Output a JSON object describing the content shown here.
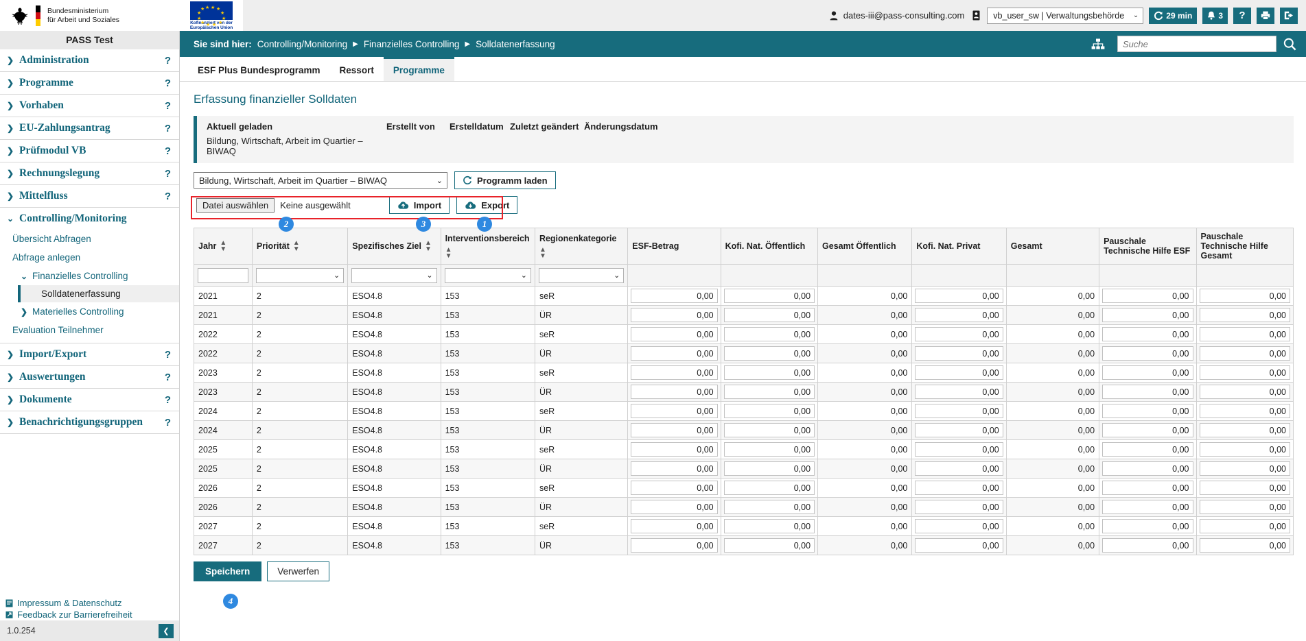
{
  "header": {
    "ministry_line1": "Bundesministerium",
    "ministry_line2": "für Arbeit und Soziales",
    "eu_caption_line1": "Kofinanziert von der",
    "eu_caption_line2": "Europäischen Union",
    "user_email": "dates-iii@pass-consulting.com",
    "user_icon": "user-icon",
    "id_card_icon": "id-card-icon",
    "role_value": "vb_user_sw | Verwaltungsbehörde",
    "session_timer": "29 min",
    "session_icon": "refresh-icon",
    "notifications_count": "3",
    "notifications_icon": "bell-icon",
    "help_label": "?",
    "help_icon": "question-mark-icon",
    "print_icon": "printer-icon",
    "logout_icon": "logout-icon"
  },
  "breadcrumb": {
    "prefix": "Sie sind hier:",
    "items": [
      "Controlling/Monitoring",
      "Finanzielles Controlling",
      "Solldatenerfassung"
    ],
    "separator": "▶",
    "sitemap_icon": "sitemap-icon",
    "search_placeholder": "Suche",
    "search_value": "",
    "search_icon": "search-icon"
  },
  "tabs": [
    {
      "label": "ESF Plus Bundesprogramm",
      "active": false
    },
    {
      "label": "Ressort",
      "active": false
    },
    {
      "label": "Programme",
      "active": true
    }
  ],
  "sidebar": {
    "app_title": "PASS Test",
    "items": [
      {
        "label": "Administration",
        "expanded": false,
        "help": "?"
      },
      {
        "label": "Programme",
        "expanded": false,
        "help": "?"
      },
      {
        "label": "Vorhaben",
        "expanded": false,
        "help": "?"
      },
      {
        "label": "EU-Zahlungsantrag",
        "expanded": false,
        "help": "?"
      },
      {
        "label": "Prüfmodul VB",
        "expanded": false,
        "help": "?"
      },
      {
        "label": "Rechnungslegung",
        "expanded": false,
        "help": "?"
      },
      {
        "label": "Mittelfluss",
        "expanded": false,
        "help": "?"
      },
      {
        "label": "Controlling/Monitoring",
        "expanded": true,
        "help": ""
      }
    ],
    "sub_items": [
      {
        "label": "Übersicht Abfragen",
        "level": 1
      },
      {
        "label": "Abfrage anlegen",
        "level": 1
      },
      {
        "label": "Finanzielles Controlling",
        "level": 2,
        "expanded": true
      },
      {
        "label": "Solldatenerfassung",
        "level": 3,
        "active": true
      },
      {
        "label": "Materielles Controlling",
        "level": 2,
        "expanded": false
      },
      {
        "label": "Evaluation Teilnehmer",
        "level": 1
      }
    ],
    "items_bottom": [
      {
        "label": "Import/Export",
        "expanded": false,
        "help": "?"
      },
      {
        "label": "Auswertungen",
        "expanded": false,
        "help": "?"
      },
      {
        "label": "Dokumente",
        "expanded": false,
        "help": "?"
      },
      {
        "label": "Benachrichtigungsgruppen",
        "expanded": false,
        "help": "?"
      }
    ],
    "footer_links": [
      {
        "label": "Impressum & Datenschutz",
        "icon": "document-icon"
      },
      {
        "label": "Feedback zur Barrierefreiheit",
        "icon": "external-link-icon"
      }
    ],
    "version": "1.0.254",
    "collapse_icon": "chevron-left-icon"
  },
  "main": {
    "page_title": "Erfassung finanzieller Solldaten",
    "loaded_panel": {
      "headers": [
        "Aktuell geladen",
        "Erstellt von",
        "Erstelldatum",
        "Zuletzt geändert",
        "Änderungsdatum"
      ],
      "values": [
        "Bildung, Wirtschaft, Arbeit im Quartier – BIWAQ",
        "",
        "",
        "",
        ""
      ]
    },
    "toolbar": {
      "program_select_value": "Bildung, Wirtschaft, Arbeit im Quartier – BIWAQ",
      "load_button": "Programm laden",
      "load_icon": "refresh-icon",
      "file_button": "Datei auswählen",
      "file_status": "Keine ausgewählt",
      "import_button": "Import",
      "import_icon": "cloud-upload-icon",
      "export_button": "Export",
      "export_icon": "cloud-download-icon"
    },
    "annotations": [
      {
        "number": "1",
        "target": "export-button"
      },
      {
        "number": "2",
        "target": "file-picker"
      },
      {
        "number": "3",
        "target": "import-button"
      },
      {
        "number": "4",
        "target": "last-table-row"
      }
    ],
    "accent_color": "#176c7d",
    "annotation_box_color": "#e8232a",
    "annotation_badge_color": "#2f89e0",
    "footer_buttons": {
      "save": "Speichern",
      "discard": "Verwerfen"
    }
  },
  "table": {
    "columns": [
      {
        "label": "Jahr",
        "sortable": true,
        "filter": "text",
        "kind": "text"
      },
      {
        "label": "Priorität",
        "sortable": true,
        "filter": "select",
        "kind": "text"
      },
      {
        "label": "Spezifisches Ziel",
        "sortable": true,
        "filter": "select",
        "kind": "text"
      },
      {
        "label": "Interventionsbereich",
        "sortable": true,
        "filter": "select",
        "kind": "text"
      },
      {
        "label": "Regionenkategorie",
        "sortable": true,
        "filter": "select",
        "kind": "text"
      },
      {
        "label": "ESF-Betrag",
        "sortable": false,
        "filter": "none",
        "kind": "input"
      },
      {
        "label": "Kofi. Nat. Öffentlich",
        "sortable": false,
        "filter": "none",
        "kind": "input"
      },
      {
        "label": "Gesamt Öffentlich",
        "sortable": false,
        "filter": "none",
        "kind": "readonly"
      },
      {
        "label": "Kofi. Nat. Privat",
        "sortable": false,
        "filter": "none",
        "kind": "input"
      },
      {
        "label": "Gesamt",
        "sortable": false,
        "filter": "none",
        "kind": "readonly"
      },
      {
        "label": "Pauschale Technische Hilfe ESF",
        "sortable": false,
        "filter": "none",
        "kind": "input"
      },
      {
        "label": "Pauschale Technische Hilfe Gesamt",
        "sortable": false,
        "filter": "none",
        "kind": "input"
      }
    ],
    "filter_values": [
      "",
      "",
      "",
      "",
      ""
    ],
    "rows": [
      {
        "jahr": "2021",
        "prioritaet": "2",
        "ziel": "ESO4.8",
        "intervention": "153",
        "region": "seR",
        "esf": "0,00",
        "kofi_oeff": "0,00",
        "gesamt_oeff": "0,00",
        "kofi_priv": "0,00",
        "gesamt": "0,00",
        "th_esf": "0,00",
        "th_gesamt": "0,00"
      },
      {
        "jahr": "2021",
        "prioritaet": "2",
        "ziel": "ESO4.8",
        "intervention": "153",
        "region": "ÜR",
        "esf": "0,00",
        "kofi_oeff": "0,00",
        "gesamt_oeff": "0,00",
        "kofi_priv": "0,00",
        "gesamt": "0,00",
        "th_esf": "0,00",
        "th_gesamt": "0,00"
      },
      {
        "jahr": "2022",
        "prioritaet": "2",
        "ziel": "ESO4.8",
        "intervention": "153",
        "region": "seR",
        "esf": "0,00",
        "kofi_oeff": "0,00",
        "gesamt_oeff": "0,00",
        "kofi_priv": "0,00",
        "gesamt": "0,00",
        "th_esf": "0,00",
        "th_gesamt": "0,00"
      },
      {
        "jahr": "2022",
        "prioritaet": "2",
        "ziel": "ESO4.8",
        "intervention": "153",
        "region": "ÜR",
        "esf": "0,00",
        "kofi_oeff": "0,00",
        "gesamt_oeff": "0,00",
        "kofi_priv": "0,00",
        "gesamt": "0,00",
        "th_esf": "0,00",
        "th_gesamt": "0,00"
      },
      {
        "jahr": "2023",
        "prioritaet": "2",
        "ziel": "ESO4.8",
        "intervention": "153",
        "region": "seR",
        "esf": "0,00",
        "kofi_oeff": "0,00",
        "gesamt_oeff": "0,00",
        "kofi_priv": "0,00",
        "gesamt": "0,00",
        "th_esf": "0,00",
        "th_gesamt": "0,00"
      },
      {
        "jahr": "2023",
        "prioritaet": "2",
        "ziel": "ESO4.8",
        "intervention": "153",
        "region": "ÜR",
        "esf": "0,00",
        "kofi_oeff": "0,00",
        "gesamt_oeff": "0,00",
        "kofi_priv": "0,00",
        "gesamt": "0,00",
        "th_esf": "0,00",
        "th_gesamt": "0,00"
      },
      {
        "jahr": "2024",
        "prioritaet": "2",
        "ziel": "ESO4.8",
        "intervention": "153",
        "region": "seR",
        "esf": "0,00",
        "kofi_oeff": "0,00",
        "gesamt_oeff": "0,00",
        "kofi_priv": "0,00",
        "gesamt": "0,00",
        "th_esf": "0,00",
        "th_gesamt": "0,00"
      },
      {
        "jahr": "2024",
        "prioritaet": "2",
        "ziel": "ESO4.8",
        "intervention": "153",
        "region": "ÜR",
        "esf": "0,00",
        "kofi_oeff": "0,00",
        "gesamt_oeff": "0,00",
        "kofi_priv": "0,00",
        "gesamt": "0,00",
        "th_esf": "0,00",
        "th_gesamt": "0,00"
      },
      {
        "jahr": "2025",
        "prioritaet": "2",
        "ziel": "ESO4.8",
        "intervention": "153",
        "region": "seR",
        "esf": "0,00",
        "kofi_oeff": "0,00",
        "gesamt_oeff": "0,00",
        "kofi_priv": "0,00",
        "gesamt": "0,00",
        "th_esf": "0,00",
        "th_gesamt": "0,00"
      },
      {
        "jahr": "2025",
        "prioritaet": "2",
        "ziel": "ESO4.8",
        "intervention": "153",
        "region": "ÜR",
        "esf": "0,00",
        "kofi_oeff": "0,00",
        "gesamt_oeff": "0,00",
        "kofi_priv": "0,00",
        "gesamt": "0,00",
        "th_esf": "0,00",
        "th_gesamt": "0,00"
      },
      {
        "jahr": "2026",
        "prioritaet": "2",
        "ziel": "ESO4.8",
        "intervention": "153",
        "region": "seR",
        "esf": "0,00",
        "kofi_oeff": "0,00",
        "gesamt_oeff": "0,00",
        "kofi_priv": "0,00",
        "gesamt": "0,00",
        "th_esf": "0,00",
        "th_gesamt": "0,00"
      },
      {
        "jahr": "2026",
        "prioritaet": "2",
        "ziel": "ESO4.8",
        "intervention": "153",
        "region": "ÜR",
        "esf": "0,00",
        "kofi_oeff": "0,00",
        "gesamt_oeff": "0,00",
        "kofi_priv": "0,00",
        "gesamt": "0,00",
        "th_esf": "0,00",
        "th_gesamt": "0,00"
      },
      {
        "jahr": "2027",
        "prioritaet": "2",
        "ziel": "ESO4.8",
        "intervention": "153",
        "region": "seR",
        "esf": "0,00",
        "kofi_oeff": "0,00",
        "gesamt_oeff": "0,00",
        "kofi_priv": "0,00",
        "gesamt": "0,00",
        "th_esf": "0,00",
        "th_gesamt": "0,00"
      },
      {
        "jahr": "2027",
        "prioritaet": "2",
        "ziel": "ESO4.8",
        "intervention": "153",
        "region": "ÜR",
        "esf": "0,00",
        "kofi_oeff": "0,00",
        "gesamt_oeff": "0,00",
        "kofi_priv": "0,00",
        "gesamt": "0,00",
        "th_esf": "0,00",
        "th_gesamt": "0,00"
      }
    ]
  }
}
